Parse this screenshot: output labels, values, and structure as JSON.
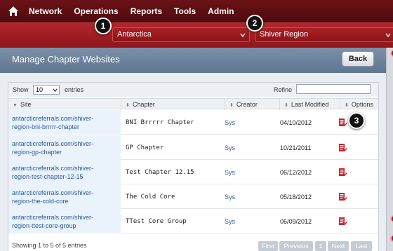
{
  "nav": {
    "items": [
      "Network",
      "Operations",
      "Reports",
      "Tools",
      "Admin"
    ]
  },
  "filters": {
    "region_group": "Antarctica",
    "region": "Shiver Region"
  },
  "callouts": [
    "1",
    "2",
    "3"
  ],
  "page": {
    "title": "Manage Chapter Websites",
    "back_label": "Back"
  },
  "table": {
    "show_label": "Show",
    "page_size": "10",
    "entries_label": "entries",
    "refine_label": "Refine",
    "columns": [
      "Site",
      "Chapter",
      "Creator",
      "Last Modified",
      "Options"
    ],
    "rows": [
      {
        "site1": "antarcticreferrals.com/shiver-",
        "site2": "region-bni-brrrrr-chapter",
        "chapter": "BNI Brrrrr Chapter",
        "creator": "Sys",
        "modified": "04/10/2012"
      },
      {
        "site1": "antarcticreferrals.com/shiver-",
        "site2": "region-gp-chapter",
        "chapter": "GP Chapter",
        "creator": "Sys",
        "modified": "10/21/2011"
      },
      {
        "site1": "antarcticreferrals.com/shiver-",
        "site2": "region-test-chapter-12-15",
        "chapter": "Test Chapter 12.15",
        "creator": "Sys",
        "modified": "06/12/2012"
      },
      {
        "site1": "antarcticreferrals.com/shiver-",
        "site2": "region-the-cold-core",
        "chapter": "The Cold Core",
        "creator": "Sys",
        "modified": "05/18/2012"
      },
      {
        "site1": "antarcticreferrals.com/shiver-",
        "site2": "region-ttest-core-group",
        "chapter": "TTest Core Group",
        "creator": "Sys",
        "modified": "06/09/2012"
      }
    ],
    "info": "Showing 1 to 5 of 5 entries",
    "pager": [
      "First",
      "Previous",
      "1",
      "Next",
      "Last"
    ]
  },
  "colors": {
    "nav_bg": "#5a0d10",
    "filter_bg": "#a01d22",
    "header_bg": "#6e849c",
    "link": "#2a5b9a",
    "option_icon": "#c0272d"
  },
  "icons": [
    "home-icon",
    "chevron-down-icon",
    "edit-page-icon"
  ]
}
